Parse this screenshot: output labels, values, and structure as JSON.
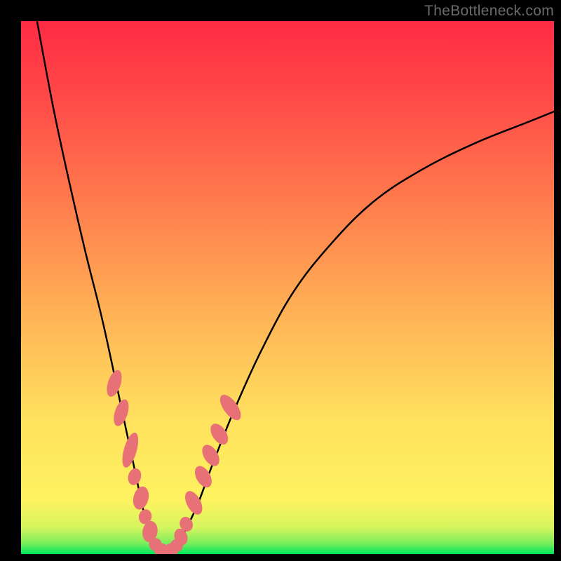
{
  "watermark": "TheBottleneck.com",
  "chart_data": {
    "type": "line",
    "title": "",
    "xlabel": "",
    "ylabel": "",
    "xlim": [
      0,
      100
    ],
    "ylim": [
      0,
      100
    ],
    "gradient": {
      "stops": [
        {
          "offset": 0.0,
          "color": "#00e65b"
        },
        {
          "offset": 0.02,
          "color": "#7aee5c"
        },
        {
          "offset": 0.05,
          "color": "#d6f55e"
        },
        {
          "offset": 0.1,
          "color": "#fef25f"
        },
        {
          "offset": 0.25,
          "color": "#ffe25e"
        },
        {
          "offset": 0.45,
          "color": "#ffb256"
        },
        {
          "offset": 0.65,
          "color": "#ff7e4d"
        },
        {
          "offset": 0.85,
          "color": "#ff4b48"
        },
        {
          "offset": 1.0,
          "color": "#ff2b44"
        }
      ]
    },
    "series": [
      {
        "name": "bottleneck-curve",
        "x": [
          3,
          6,
          9,
          12,
          15,
          17,
          18.5,
          20,
          21.5,
          23,
          24.5,
          26,
          28,
          30,
          33,
          36,
          40,
          45,
          51,
          58,
          66,
          75,
          85,
          95,
          100
        ],
        "y": [
          100,
          84,
          70,
          57,
          45,
          36,
          29,
          22,
          15,
          8,
          3,
          0.5,
          0.5,
          3,
          9,
          17,
          27,
          38,
          49,
          58,
          66,
          72,
          77,
          81,
          83
        ]
      }
    ],
    "markers": [
      {
        "x": 17.5,
        "y": 32,
        "rx": 1.2,
        "ry": 2.6,
        "angle": 18
      },
      {
        "x": 18.8,
        "y": 26.5,
        "rx": 1.2,
        "ry": 2.6,
        "angle": 18
      },
      {
        "x": 20.5,
        "y": 19.5,
        "rx": 1.2,
        "ry": 3.4,
        "angle": 16
      },
      {
        "x": 21.3,
        "y": 14.5,
        "rx": 1.2,
        "ry": 1.6,
        "angle": 16
      },
      {
        "x": 22.5,
        "y": 10.5,
        "rx": 1.4,
        "ry": 2.2,
        "angle": 14
      },
      {
        "x": 23.3,
        "y": 7.0,
        "rx": 1.2,
        "ry": 1.4,
        "angle": 12
      },
      {
        "x": 24.2,
        "y": 4.2,
        "rx": 1.4,
        "ry": 2.0,
        "angle": 10
      },
      {
        "x": 25.2,
        "y": 1.8,
        "rx": 1.2,
        "ry": 1.2,
        "angle": 0
      },
      {
        "x": 26.3,
        "y": 0.8,
        "rx": 1.4,
        "ry": 1.2,
        "angle": 0
      },
      {
        "x": 27.2,
        "y": 0.6,
        "rx": 1.0,
        "ry": 1.0,
        "angle": 0
      },
      {
        "x": 28.2,
        "y": 0.8,
        "rx": 1.4,
        "ry": 1.2,
        "angle": 0
      },
      {
        "x": 29.2,
        "y": 1.6,
        "rx": 1.2,
        "ry": 1.2,
        "angle": 0
      },
      {
        "x": 30.0,
        "y": 3.2,
        "rx": 1.2,
        "ry": 1.6,
        "angle": -20
      },
      {
        "x": 31.0,
        "y": 5.6,
        "rx": 1.2,
        "ry": 1.4,
        "angle": -25
      },
      {
        "x": 32.4,
        "y": 9.6,
        "rx": 1.3,
        "ry": 2.4,
        "angle": -28
      },
      {
        "x": 34.2,
        "y": 14.5,
        "rx": 1.3,
        "ry": 2.2,
        "angle": -30
      },
      {
        "x": 35.6,
        "y": 18.5,
        "rx": 1.3,
        "ry": 2.2,
        "angle": -32
      },
      {
        "x": 37.2,
        "y": 22.5,
        "rx": 1.3,
        "ry": 2.2,
        "angle": -34
      },
      {
        "x": 39.3,
        "y": 27.5,
        "rx": 1.3,
        "ry": 2.8,
        "angle": -36
      }
    ]
  }
}
